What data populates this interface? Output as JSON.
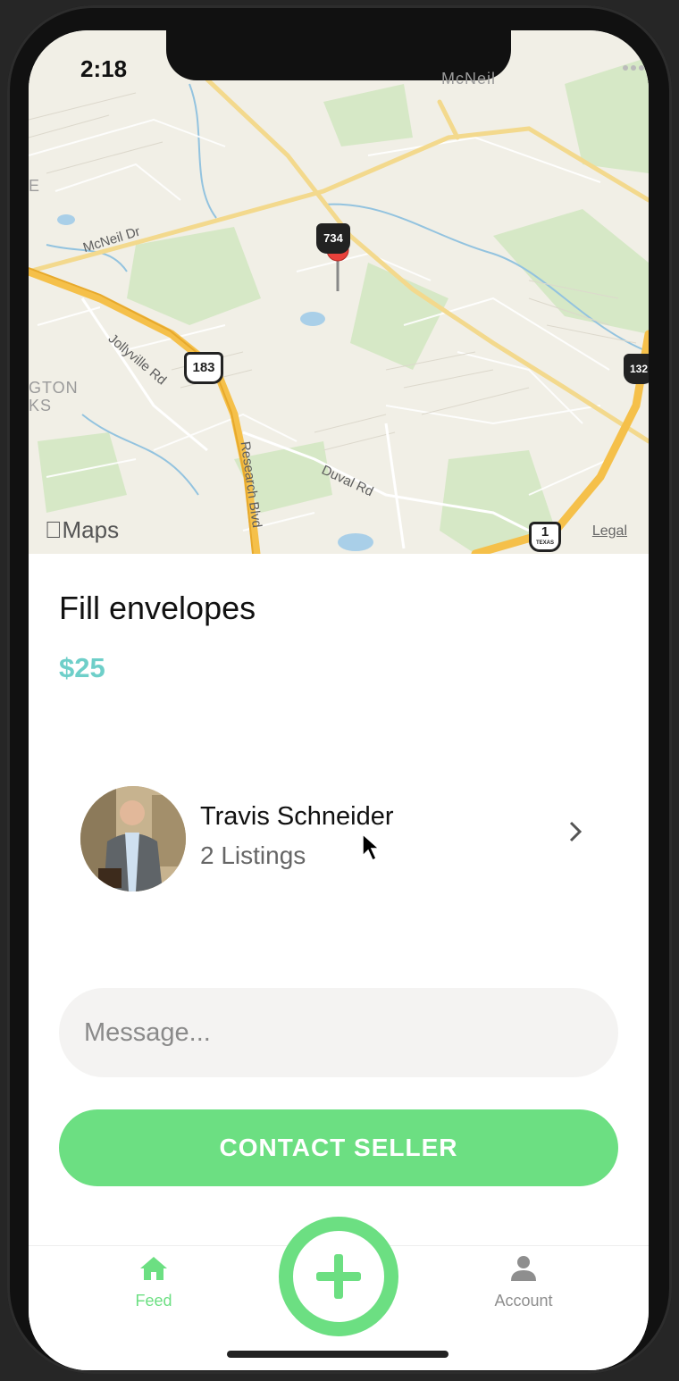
{
  "status_bar": {
    "time": "2:18"
  },
  "map": {
    "branding": "Maps",
    "legal": "Legal",
    "labels": {
      "area_mcneil": "McNeil",
      "road_mcneil_dr": "McNeil Dr",
      "road_jollyville": "Jollyville Rd",
      "road_research": "Research Blvd",
      "road_duval": "Duval Rd",
      "area_gton": "GTON",
      "area_ks": "KS",
      "area_e": "E"
    },
    "shields": {
      "us183": "183",
      "tx734": "734",
      "tx1": "1",
      "tx1_sub": "TEXAS",
      "tx1325": "132"
    }
  },
  "listing": {
    "title": "Fill envelopes",
    "price": "$25"
  },
  "seller": {
    "name": "Travis Schneider",
    "listings": "2 Listings"
  },
  "message": {
    "placeholder": "Message..."
  },
  "contact_button": {
    "label": "CONTACT SELLER"
  },
  "tabbar": {
    "feed": "Feed",
    "account": "Account"
  },
  "colors": {
    "accent_green": "#6cdf82",
    "price_teal": "#6ecfc9",
    "pin_red": "#e8413b"
  },
  "icons": [
    "map-pin-icon",
    "chevron-right-icon",
    "home-icon",
    "plus-icon",
    "person-icon",
    "wifi-icon",
    "battery-icon",
    "signal-icon",
    "apple-icon"
  ]
}
